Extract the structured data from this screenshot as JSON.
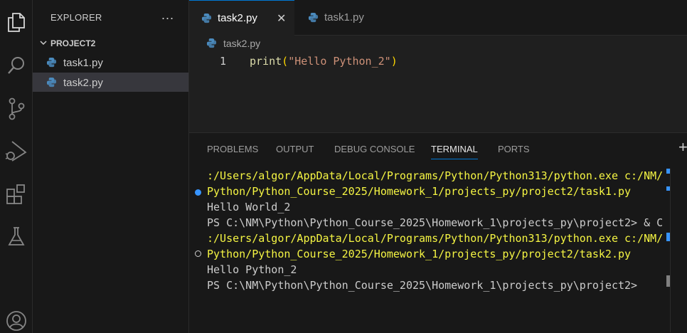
{
  "sidebar": {
    "title": "EXPLORER",
    "more_actions": "...",
    "project": "PROJECT2",
    "files": [
      {
        "name": "task1.py",
        "selected": false
      },
      {
        "name": "task2.py",
        "selected": true
      }
    ]
  },
  "activity_icons": [
    "explorer-icon",
    "search-icon",
    "source-control-icon",
    "run-debug-icon",
    "extensions-icon",
    "testing-icon",
    "account-icon"
  ],
  "tabs": [
    {
      "label": "task2.py",
      "active": true,
      "close": "✕"
    },
    {
      "label": "task1.py",
      "active": false
    }
  ],
  "breadcrumb": {
    "file": "task2.py"
  },
  "editor": {
    "line_number": "1",
    "code": {
      "fn": "print",
      "open": "(",
      "str": "\"Hello Python_2\"",
      "close": ")"
    }
  },
  "panel": {
    "tabs": [
      {
        "label": "PROBLEMS",
        "active": false
      },
      {
        "label": "OUTPUT",
        "active": false
      },
      {
        "label": "DEBUG CONSOLE",
        "active": false
      },
      {
        "label": "TERMINAL",
        "active": true
      },
      {
        "label": "PORTS",
        "active": false
      }
    ],
    "plus": "+",
    "terminal_lines": [
      ":/Users/algor/AppData/Local/Programs/Python/Python313/python.exe c:/NM/",
      "Python/Python_Course_2025/Homework_1/projects_py/project2/task1.py",
      "Hello World_2",
      "PS C:\\NM\\Python\\Python_Course_2025\\Homework_1\\projects_py\\project2> & C",
      ":/Users/algor/AppData/Local/Programs/Python/Python313/python.exe c:/NM/",
      "Python/Python_Course_2025/Homework_1/projects_py/project2/task2.py",
      "Hello Python_2",
      "PS C:\\NM\\Python\\Python_Course_2025\\Homework_1\\projects_py\\project2>"
    ]
  },
  "colors": {
    "accent": "#0078d4",
    "terminal_yellow": "#f5f543",
    "decoration_blue": "#3794ff",
    "python_icon": "#4b8bbe"
  }
}
